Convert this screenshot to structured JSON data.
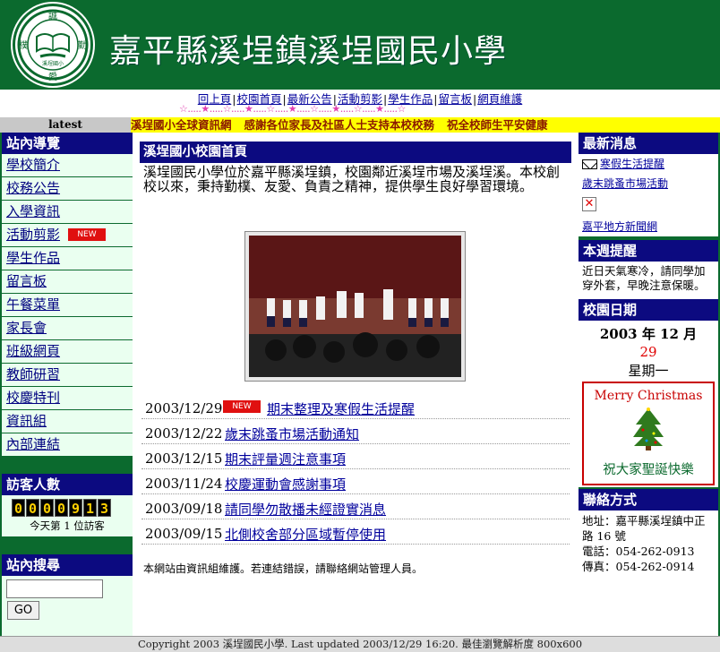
{
  "header": {
    "title": "嘉平縣溪埕鎮溪埕國民小學",
    "logo_text": {
      "top": "誠",
      "left": "樸",
      "right": "勤",
      "bottom": "愛",
      "school": "溪埕國小"
    }
  },
  "topnav": {
    "links": [
      "回上頁",
      "校園首頁",
      "最新公告",
      "活動剪影",
      "學生作品",
      "留言板",
      "網頁維護"
    ]
  },
  "starline": "☆.....★.....☆.....★.....☆.....★.....☆.....★.....☆.....★.....☆",
  "latest": {
    "label": "latest",
    "items": [
      "溪埕國小全球資訊網",
      "感謝各位家長及社區人士支持本校校務",
      "祝全校師生平安健康"
    ]
  },
  "left": {
    "nav_title": "站內導覽",
    "nav_items": [
      {
        "label": "學校簡介"
      },
      {
        "label": "校務公告"
      },
      {
        "label": "入學資訊"
      },
      {
        "label": "活動剪影",
        "badge": "NEW"
      },
      {
        "label": "學生作品"
      },
      {
        "label": "留言板"
      },
      {
        "label": "午餐菜單"
      },
      {
        "label": "家長會"
      },
      {
        "label": "班級網頁"
      },
      {
        "label": "教師研習"
      },
      {
        "label": "校慶特刊"
      },
      {
        "label": "資訊組"
      },
      {
        "label": "內部連結"
      }
    ],
    "counter_title": "訪客人數",
    "counter_digits": [
      "0",
      "0",
      "0",
      "0",
      "9",
      "1",
      "3"
    ],
    "counter_caption": "今天第 1 位訪客",
    "search_title": "站內搜尋",
    "search_placeholder": "",
    "search_button": "GO"
  },
  "center": {
    "title": "溪埕國小校園首頁",
    "intro": "溪埕國民小學位於嘉平縣溪埕鎮，校園鄰近溪埕市場及溪埕溪。本校創校以來，秉持勤樸、友愛、負責之精神，提供學生良好學習環境。",
    "news": [
      {
        "date": "2003/12/29",
        "badge": "NEW",
        "title": "期末整理及寒假生活提醒"
      },
      {
        "date": "2003/12/22",
        "title": "歲末跳蚤市場活動通知"
      },
      {
        "date": "2003/12/15",
        "title": "期末評量週注意事項"
      },
      {
        "date": "2003/11/24",
        "title": "校慶運動會感謝事項"
      },
      {
        "date": "2003/09/18",
        "title": "請同學勿散播未經證實消息"
      },
      {
        "date": "2003/09/15",
        "title": "北側校舍部分區域暫停使用"
      }
    ],
    "footnote": "本網站由資訊組維護。若連結錯誤，請聯絡網站管理人員。"
  },
  "right": {
    "news_title": "最新消息",
    "news_links": [
      "寒假生活提醒",
      "歲末跳蚤市場活動",
      "嘉平地方新聞網"
    ],
    "notice_title": "本週提醒",
    "notice_text": "近日天氣寒冷，請同學加穿外套，早晚注意保暖。",
    "calendar_title": "校園日期",
    "calendar_date": "2003 年 12 月",
    "calendar_day": "29",
    "calendar_weekday": "星期一",
    "xmas_title": "Merry Christmas",
    "xmas_wish": "祝大家聖誕快樂",
    "contact_title": "聯絡方式",
    "contact_address": "地址：嘉平縣溪埕鎮中正路 16 號",
    "contact_phone": "電話：054-262-0913",
    "contact_fax": "傳真：054-262-0914"
  },
  "footer": "Copyright 2003 溪埕國民小學. Last updated 2003/12/29 16:20. 最佳瀏覽解析度 800x600",
  "colors": {
    "header_green": "#0b6a2e",
    "section_navy": "#0c0a80",
    "marquee_yellow": "#ffff00",
    "badge_red": "#e01010"
  }
}
